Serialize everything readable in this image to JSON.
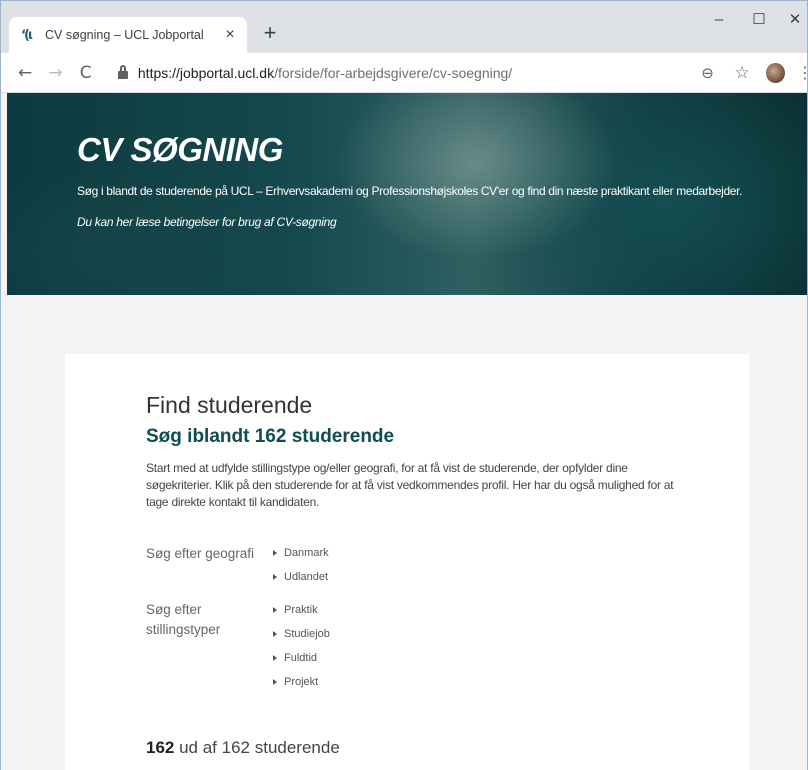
{
  "browser": {
    "tab_title": "CV søgning – UCL Jobportal",
    "tab_favicon": "ʻ(ι",
    "new_tab": "+",
    "close_tab": "×",
    "window_minimize": "–",
    "window_maximize": "☐",
    "window_close": "✕",
    "nav_back": "←",
    "nav_forward": "→",
    "nav_reload": "C",
    "url_host": "https://jobportal.ucl.dk",
    "url_path": "/forside/for-arbejdsgivere/cv-soegning/",
    "zoom_icon": "⊖",
    "star_icon": "☆",
    "menu_icon": "⋮"
  },
  "hero": {
    "title": "CV SØGNING",
    "text": "Søg i blandt de studerende på UCL – Erhvervsakademi og Professionshøjskoles CV'er og find din næste praktikant eller medarbejder.",
    "link": "Du kan her læse betingelser for brug af CV-søgning"
  },
  "main": {
    "heading": "Find studerende",
    "subheading": "Søg iblandt 162 studerende",
    "intro": "Start med at udfylde stillingstype og/eller geografi, for at få vist de studerende, der opfylder dine søgekriterier. Klik på den studerende for at få vist vedkommendes profil. Her har du også mulighed for at tage direkte kontakt til kandidaten.",
    "geo_label": "Søg efter geografi",
    "geo_options": [
      "Danmark",
      "Udlandet"
    ],
    "job_label": "Søg efter stillingstyper",
    "job_options": [
      "Praktik",
      "Studiejob",
      "Fuldtid",
      "Projekt"
    ],
    "result_count": "162",
    "result_text": " ud af 162 studerende"
  },
  "colors": {
    "accent": "#0e4d52",
    "hero_bg": "#14494d"
  }
}
